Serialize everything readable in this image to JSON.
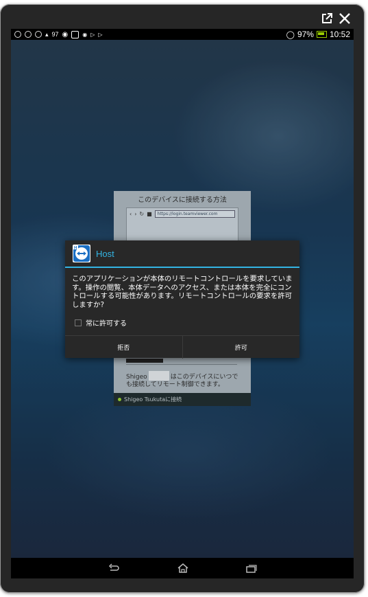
{
  "status_bar": {
    "left_text": "97",
    "battery": "97%",
    "time": "10:52"
  },
  "background_card": {
    "title": "このデバイスに接続する方法",
    "url": "https://login.teamviewer.com",
    "text_name": "Shigeo",
    "text_line1": "はこのデバイスにいつで",
    "text_line2": "も接続してリモート制御できます。",
    "status": "Shigeo Tsukutaに接続"
  },
  "dialog": {
    "app_name": "Host",
    "message": "このアプリケーションが本体のリモートコントロールを要求しています。操作の閲覧、本体データへのアクセス、または本体を完全にコントロールする可能性があります。リモートコントロールの要求を許可しますか?",
    "checkbox_label": "常に許可する",
    "deny_label": "拒否",
    "allow_label": "許可"
  },
  "icons": [
    "open-external-icon",
    "close-icon",
    "wifi-icon",
    "battery-icon",
    "teamviewer-icon",
    "back-icon",
    "home-icon",
    "recent-apps-icon"
  ],
  "colors": {
    "accent": "#33b5e5",
    "battery": "#99cc00"
  }
}
